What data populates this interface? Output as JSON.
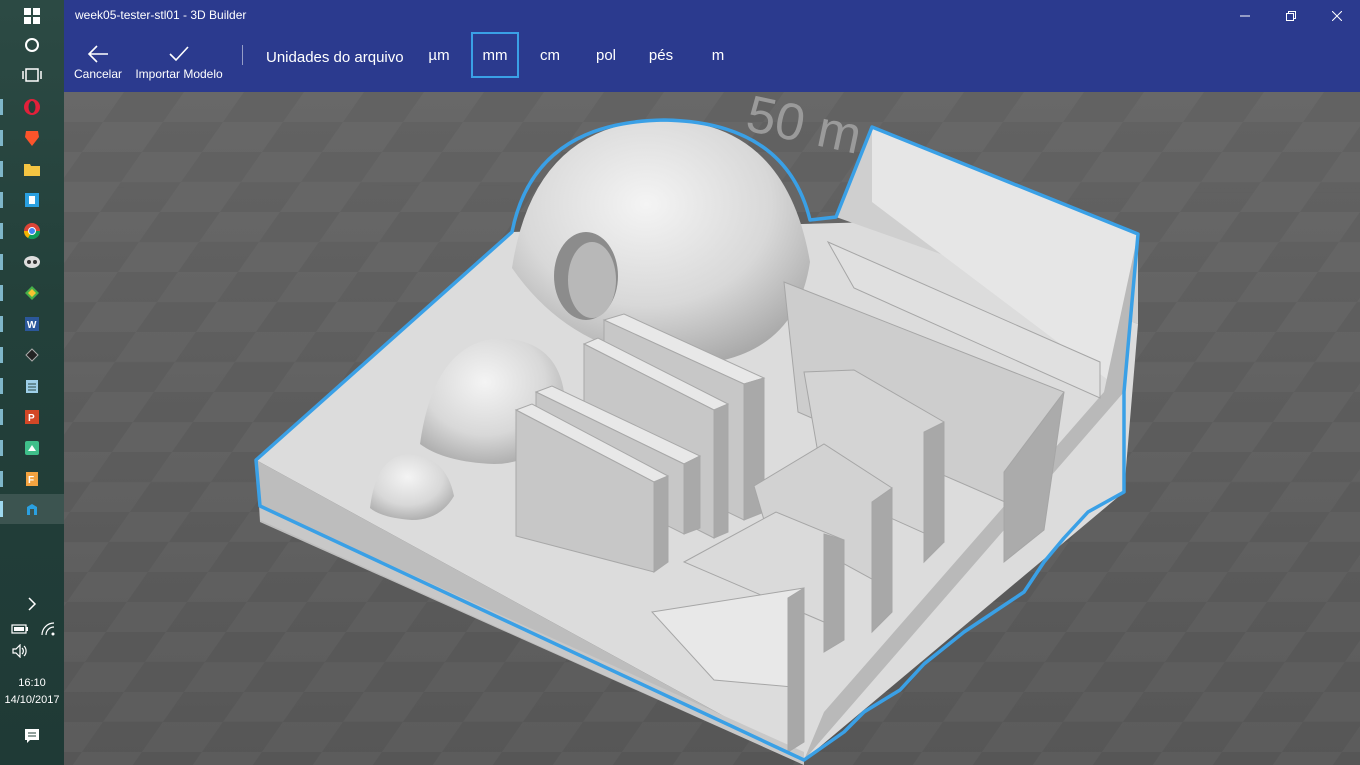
{
  "window": {
    "title": "week05-tester-stl01 - 3D Builder"
  },
  "toolbar": {
    "cancel_label": "Cancelar",
    "import_label": "Importar Modelo",
    "units_label": "Unidades do arquivo",
    "units": [
      "µm",
      "mm",
      "cm",
      "pol",
      "pés",
      "m"
    ],
    "selected_unit": "mm"
  },
  "viewport": {
    "grid_label": "50 m"
  },
  "taskbar": {
    "time": "16:10",
    "date": "14/10/2017",
    "pinned_icons": [
      "opera-icon",
      "brave-icon",
      "file-explorer-icon",
      "app-icon",
      "chrome-icon",
      "app-icon",
      "app-icon",
      "word-icon",
      "app-icon",
      "notepad-icon",
      "powerpoint-icon",
      "app-icon",
      "app-icon",
      "3d-builder-icon"
    ]
  },
  "colors": {
    "accent": "#2b3a8e",
    "selection": "#3aa0e6"
  }
}
